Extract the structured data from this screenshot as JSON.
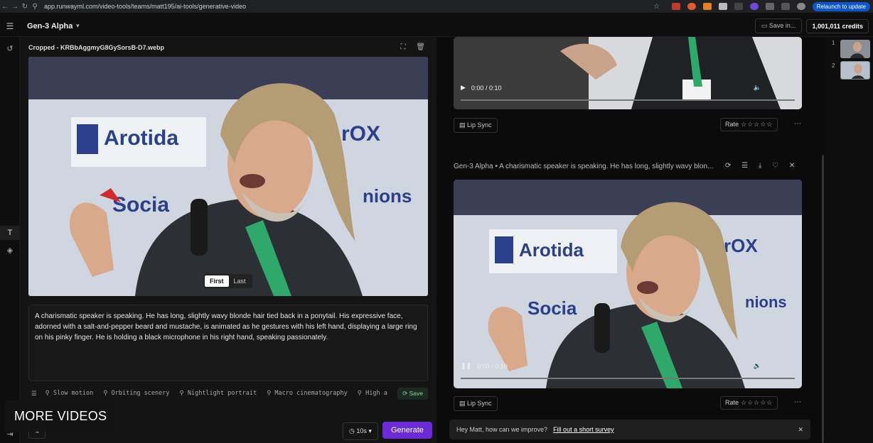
{
  "browser": {
    "url": "app.runwayml.com/video-tools/teams/matt195/ai-tools/generative-video",
    "relaunch": "Relaunch to update"
  },
  "app": {
    "title": "Gen-3 Alpha",
    "save_label": "Save in...",
    "credits": "1,001,011 credits"
  },
  "left": {
    "file_name": "Cropped - KRBbAggmyG8GySorsB-D7.webp",
    "frame_first": "First",
    "frame_last": "Last",
    "prompt": "A charismatic speaker is speaking. He has long, slightly wavy blonde hair tied back in a ponytail. His expressive face, adorned with a salt-and-pepper beard and mustache, is animated as he gestures with his left hand, displaying a large ring on his pinky finger. He is holding a black microphone in his right hand, speaking passionately.",
    "chips": [
      "Slow motion",
      "Orbiting scenery",
      "Nightlight portrait",
      "Macro cinematography",
      "High a"
    ],
    "save_chip": "Save",
    "duration": "10s",
    "generate": "Generate",
    "overlay": "MORE VIDEOS"
  },
  "right": {
    "video1_time": "0:00 / 0:10",
    "video2_time": "0:00 / 0:10",
    "lip_sync": "Lip Sync",
    "rate": "Rate",
    "video2_title": "Gen-3 Alpha • A charismatic speaker is speaking. He has long, slightly wavy blon...",
    "survey_text": "Hey Matt, how can we improve?",
    "survey_link": "Fill out a short survey"
  },
  "thumbs": [
    "1",
    "2"
  ],
  "image_text": {
    "brand1": "Arotida",
    "brand2": "Socia",
    "brand3": "rOX",
    "brand4": "nions"
  },
  "colors": {
    "accent": "#6b2bd9",
    "save_chip": "#7ed8a2",
    "relaunch": "#0b57d0"
  }
}
